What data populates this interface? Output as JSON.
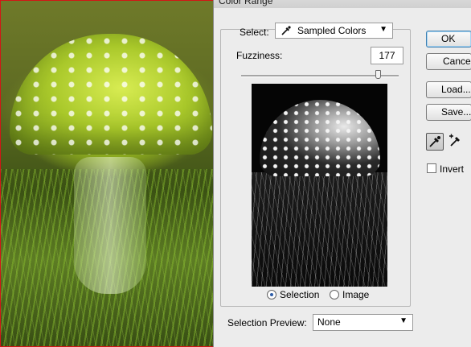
{
  "window": {
    "title": "Color Range"
  },
  "select": {
    "label": "Select:",
    "value": "Sampled Colors",
    "icon": "eyedropper-icon"
  },
  "fuzziness": {
    "label": "Fuzziness:",
    "value": "177",
    "slider_fraction": 0.87
  },
  "preview_mode": {
    "selection_label": "Selection",
    "image_label": "Image",
    "selected": "Selection"
  },
  "selection_preview": {
    "label": "Selection Preview:",
    "value": "None"
  },
  "buttons": {
    "ok": "OK",
    "cancel": "Cancel",
    "load": "Load...",
    "save": "Save..."
  },
  "tools": [
    "eyedropper-icon",
    "eyedropper-plus-icon"
  ],
  "invert": {
    "label": "Invert",
    "checked": false
  },
  "colors": {
    "accent": "#3c7fb1",
    "canvas_border": "#d21616"
  }
}
